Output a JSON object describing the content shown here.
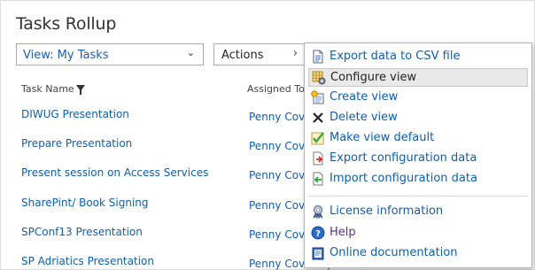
{
  "title": "Tasks Rollup",
  "view_select": {
    "value": "View: My Tasks"
  },
  "actions_button": {
    "label": "Actions"
  },
  "columns": {
    "task_name": "Task Name",
    "assigned_to": "Assigned To"
  },
  "tasks": [
    {
      "name": "DIWUG Presentation",
      "assigned": "Penny Coventry"
    },
    {
      "name": "Prepare Presentation",
      "assigned": "Penny Coventry"
    },
    {
      "name": "Present session on Access Services",
      "assigned": "Penny Coventry"
    },
    {
      "name": "SharePint/ Book Signing",
      "assigned": "Penny Coventry"
    },
    {
      "name": "SPConf13 Presentation",
      "assigned": "Penny Coventry"
    },
    {
      "name": "SP Adriatics Presentation",
      "assigned": "Penny Coventry"
    }
  ],
  "menu": {
    "export_csv": "Export data to CSV file",
    "configure_view": "Configure view",
    "create_view": "Create view",
    "delete_view": "Delete view",
    "make_default": "Make view default",
    "export_config": "Export configuration data",
    "import_config": "Import configuration data",
    "license": "License information",
    "help": "Help",
    "online_docs": "Online documentation"
  },
  "colors": {
    "link": "#0f5fad",
    "help_link": "#5a2d92",
    "hover_bg": "#e9e9e9"
  }
}
